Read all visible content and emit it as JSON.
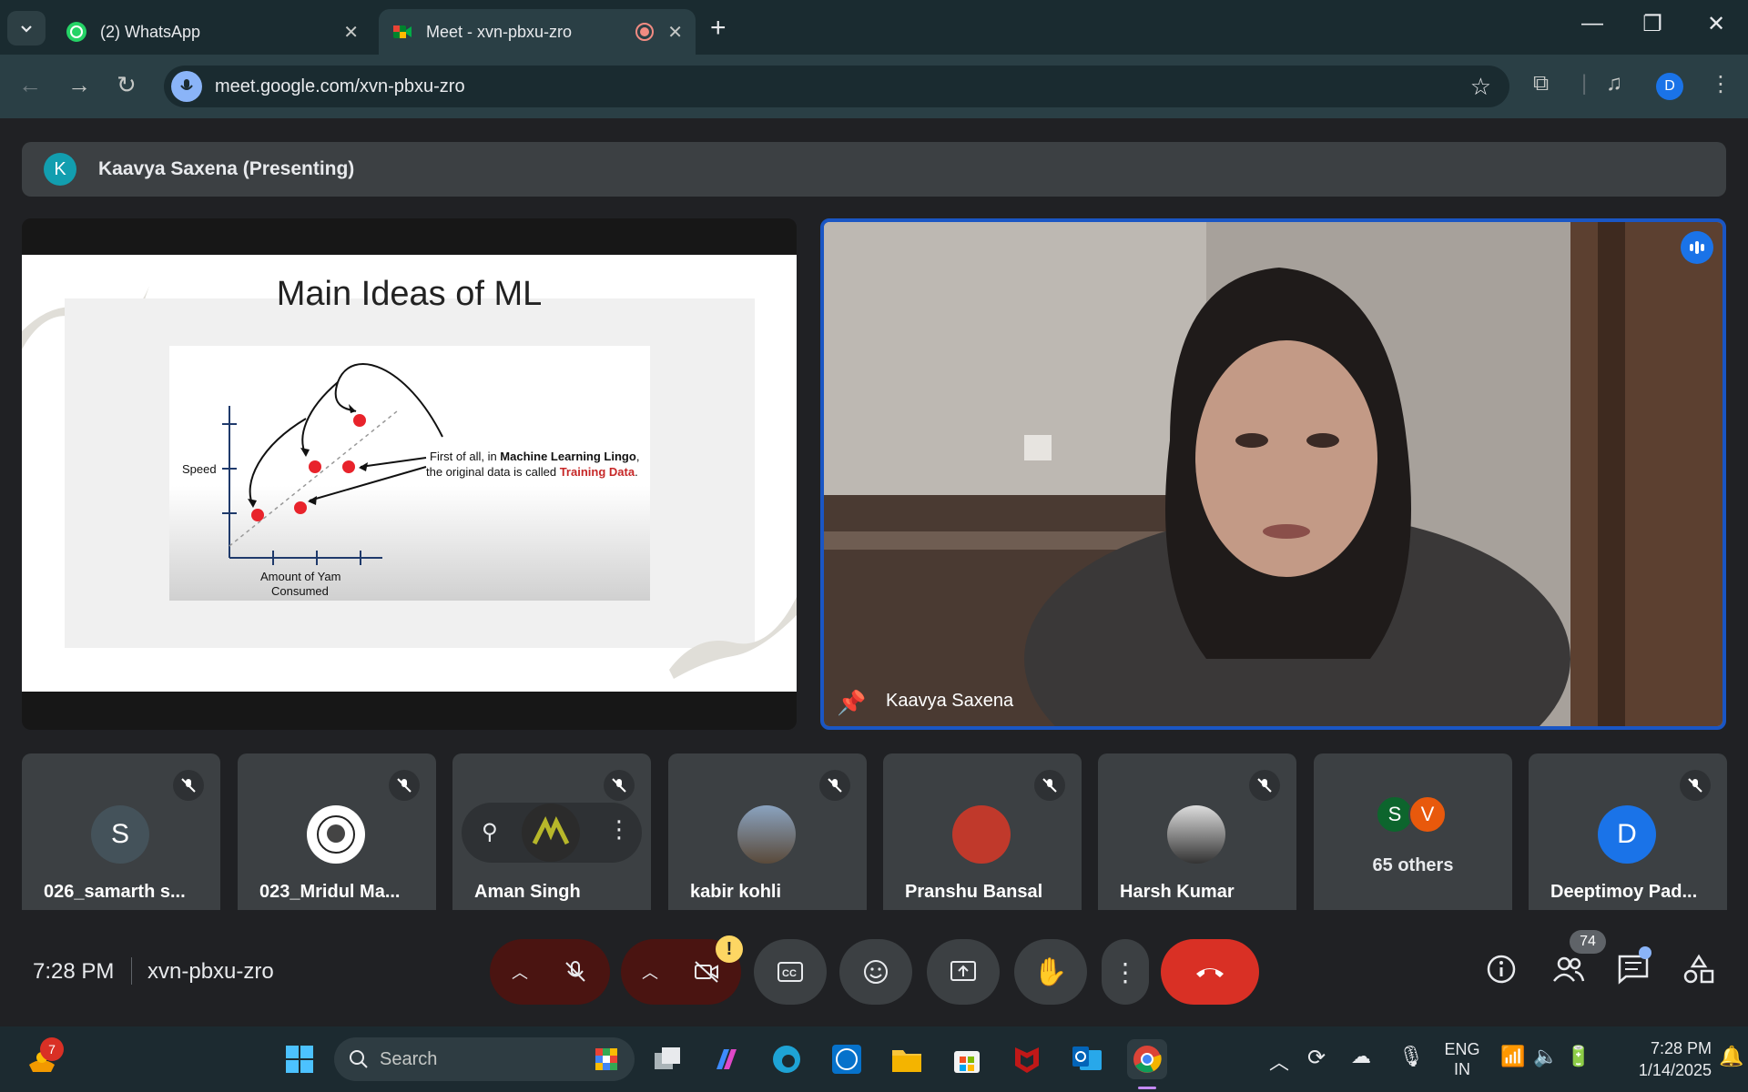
{
  "browser": {
    "tabs": [
      {
        "title": "(2) WhatsApp",
        "icon": "whatsapp-icon",
        "active": false
      },
      {
        "title": "Meet - xvn-pbxu-zro",
        "icon": "google-meet-icon",
        "active": true
      }
    ],
    "url": "meet.google.com/xvn-pbxu-zro",
    "profile_initial": "D"
  },
  "meet": {
    "presenting_avatar": "K",
    "presenting_label": "Kaavya Saxena (Presenting)",
    "slide": {
      "title": "Main Ideas of ML",
      "y_label": "Speed",
      "x_label_line1": "Amount of Yam",
      "x_label_line2": "Consumed",
      "caption_line1_prefix": "First of all, in ",
      "caption_line1_bold": "Machine Learning Lingo",
      "caption_line1_suffix": ",",
      "caption_line2_prefix": "the original data is called ",
      "caption_line2_highlight": "Training Data",
      "caption_line2_suffix": "."
    },
    "main_video_name": "Kaavya Saxena",
    "participants": [
      {
        "name": "026_samarth s...",
        "initial": "S",
        "avatar_color": "#44525a"
      },
      {
        "name": "023_Mridul Ma...",
        "initial": "",
        "avatar_color": "#ffffff"
      },
      {
        "name": "Aman Singh",
        "initial": "",
        "avatar_color": "#2b2b2b"
      },
      {
        "name": "kabir kohli",
        "initial": "",
        "avatar_color": "#5a4a3a"
      },
      {
        "name": "Pranshu Bansal",
        "initial": "",
        "avatar_color": "#c0392b"
      },
      {
        "name": "Harsh Kumar",
        "initial": "",
        "avatar_color": "#555555"
      },
      {
        "name": "Deeptimoy Pad...",
        "initial": "D",
        "avatar_color": "#1a73e8"
      }
    ],
    "others": {
      "label": "65 others",
      "initial_a": "S",
      "initial_b": "V"
    },
    "clock": "7:28 PM",
    "meeting_code": "xvn-pbxu-zro",
    "people_count": "74",
    "warning_badge": "!"
  },
  "taskbar": {
    "search_label": "Search",
    "notification_count": "7",
    "lang_line1": "ENG",
    "lang_line2": "IN",
    "time": "7:28 PM",
    "date": "1/14/2025"
  },
  "colors": {
    "accent": "#1a73e8",
    "hangup": "#d93025",
    "training_data": "#c62828"
  }
}
